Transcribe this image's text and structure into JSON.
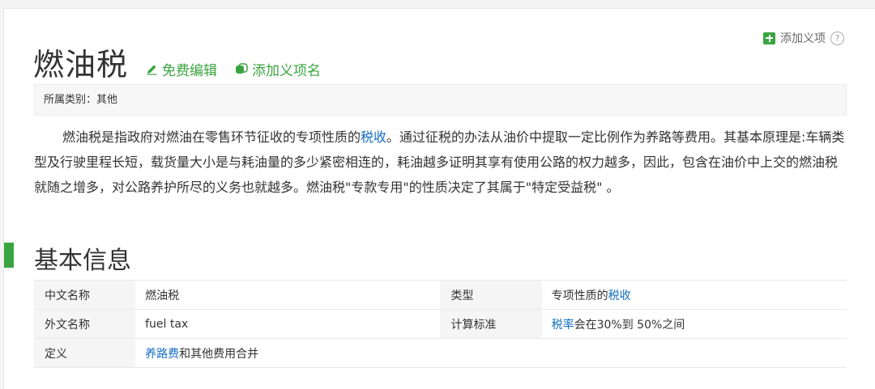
{
  "header": {
    "add_item_label": "添加义项",
    "help_glyph": "?",
    "title": "燃油税",
    "edit_label": "免费编辑",
    "add_name_label": "添加义项名"
  },
  "category": {
    "text": "所属类别：其他"
  },
  "description": {
    "part1": "燃油税是指政府对燃油在零售环节征收的专项性质的",
    "link1": "税收",
    "part2": "。通过征税的办法从油价中提取一定比例作为养路等费用。其基本原理是:车辆类型及行驶里程长短，载货量大小是与耗油量的多少紧密相连的，耗油越多证明其享有使用公路的权力越多，因此，包含在油价中上交的燃油税就随之增多，对公路养护所尽的义务也就越多。燃油税\"专款专用\"的性质决定了其属于\"特定受益税\" 。"
  },
  "basic_info": {
    "section_title": "基本信息",
    "rows": [
      {
        "k1": "中文名称",
        "v1": "燃油税",
        "k2": "类型",
        "v2_prefix": "专项性质的",
        "v2_link": "税收",
        "v2_suffix": ""
      },
      {
        "k1": "外文名称",
        "v1": "fuel tax",
        "k2": "计算标准",
        "v2_prefix": "",
        "v2_link": "税率",
        "v2_suffix": "会在30%到 50%之间"
      },
      {
        "k1": "定义",
        "v1_link": "养路费",
        "v1_suffix": "和其他费用合并"
      }
    ]
  },
  "colors": {
    "accent_green": "#3aa540",
    "link_blue": "#136ec2"
  }
}
